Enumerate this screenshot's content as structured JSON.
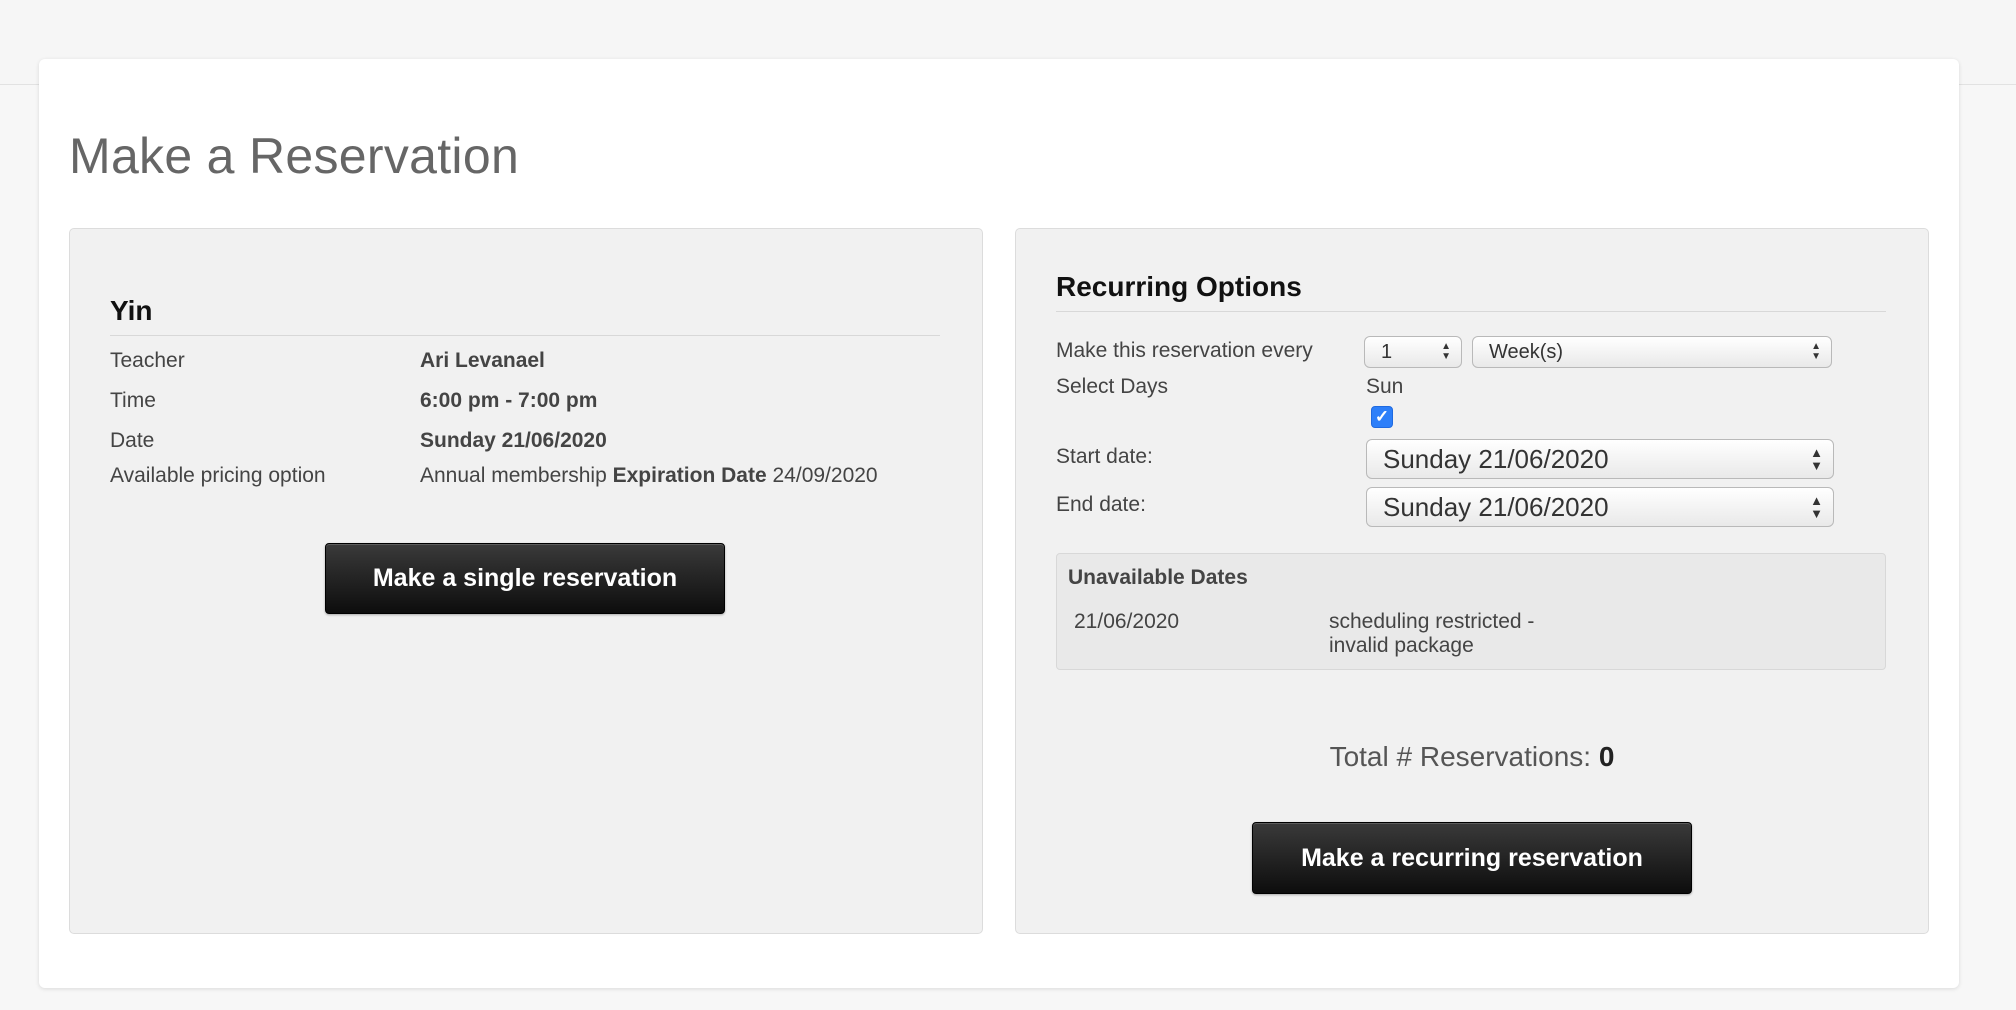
{
  "page": {
    "title": "Make a Reservation"
  },
  "class_info": {
    "name": "Yin",
    "details": [
      {
        "label": "Teacher",
        "value": "Ari Levanael"
      },
      {
        "label": "Time",
        "value": "6:00 pm - 7:00 pm"
      },
      {
        "label": "Date",
        "value": "Sunday 21/06/2020"
      }
    ],
    "pricing": {
      "label": "Available pricing option",
      "option": "Annual membership",
      "expiration_label": "Expiration Date",
      "expiration_date": "24/09/2020"
    },
    "single_button_label": "Make a single reservation"
  },
  "recurring": {
    "title": "Recurring Options",
    "every_label": "Make this reservation every",
    "interval_value": "1",
    "unit_value": "Week(s)",
    "select_days_label": "Select Days",
    "day": "Sun",
    "day_checked": true,
    "start_label": "Start date:",
    "start_value": "Sunday 21/06/2020",
    "end_label": "End date:",
    "end_value": "Sunday 21/06/2020",
    "unavailable": {
      "title": "Unavailable Dates",
      "items": [
        {
          "date": "21/06/2020",
          "reason": "scheduling restricted - invalid package"
        }
      ]
    },
    "total_label": "Total # Reservations:",
    "total_value": "0",
    "recurring_button_label": "Make a recurring reservation"
  },
  "colors": {
    "checkbox": "#2d7ff9",
    "button": "#111111"
  }
}
